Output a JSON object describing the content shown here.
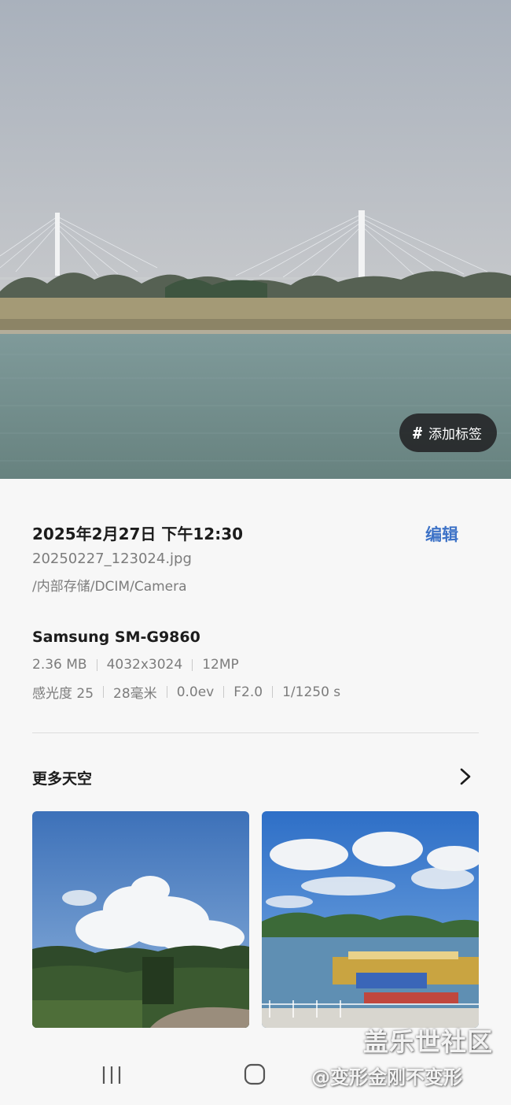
{
  "photo": {
    "description_icon": "landscape-photo",
    "tag_button": {
      "icon": "hash-icon",
      "label": "添加标签"
    }
  },
  "details": {
    "datetime": "2025年2月27日 下午12:30",
    "edit_label": "编辑",
    "filename": "20250227_123024.jpg",
    "path": "/内部存储/DCIM/Camera",
    "device": "Samsung SM-G9860",
    "file_specs": [
      "2.36 MB",
      "4032x3024",
      "12MP"
    ],
    "camera_specs": [
      "感光度 25",
      "28毫米",
      "0.0ev",
      "F2.0",
      "1/1250 s"
    ]
  },
  "related": {
    "title": "更多天空",
    "chevron_icon": "chevron-right-icon"
  },
  "nav": {
    "recent_icon": "recent-apps-icon",
    "home_icon": "home-icon"
  },
  "watermark": {
    "line1": "盖乐世社区",
    "line2": "@变形金刚不变形"
  },
  "colors": {
    "accent": "#3e73c7",
    "background": "#f7f7f7",
    "pill": "#222224"
  }
}
